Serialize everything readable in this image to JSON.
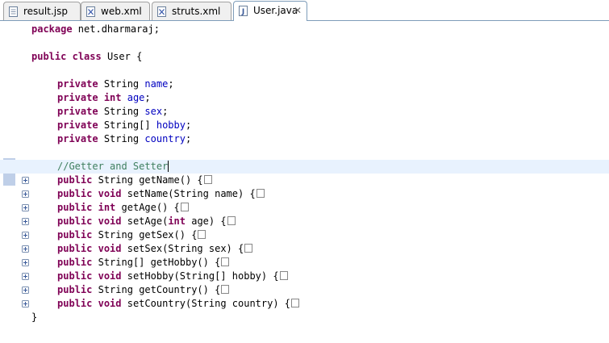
{
  "tabs": [
    {
      "label": "result.jsp",
      "icon": "jsp-file-icon"
    },
    {
      "label": "web.xml",
      "icon": "xml-file-icon"
    },
    {
      "label": "struts.xml",
      "icon": "xml-file-icon"
    },
    {
      "label": "User.java",
      "icon": "java-file-icon",
      "active": true,
      "close": "✕"
    }
  ],
  "code": {
    "line1": {
      "kw": "package",
      "rest": " net.dharmaraj;"
    },
    "line3": {
      "kw1": "public",
      "kw2": "class",
      "rest": " User {"
    },
    "fields": [
      {
        "mod": "private",
        "type": "String",
        "typeKw": false,
        "name": "name"
      },
      {
        "mod": "private",
        "type": "int",
        "typeKw": true,
        "name": "age"
      },
      {
        "mod": "private",
        "type": "String",
        "typeKw": false,
        "name": "sex"
      },
      {
        "mod": "private",
        "type": "String[]",
        "typeKw": false,
        "name": "hobby"
      },
      {
        "mod": "private",
        "type": "String",
        "typeKw": false,
        "name": "country"
      }
    ],
    "comment": "//Getter and Setter",
    "methods": [
      {
        "kw": "public",
        "type": "String",
        "typeKw": false,
        "sig": "getName() {"
      },
      {
        "kw": "public",
        "type": "void",
        "typeKw": true,
        "sig": "setName(String name) {"
      },
      {
        "kw": "public",
        "type": "int",
        "typeKw": true,
        "sig": "getAge() {"
      },
      {
        "kw": "public",
        "type": "void",
        "typeKw": true,
        "sig": "setAge(",
        "paramKw": "int",
        "sigRest": " age) {"
      },
      {
        "kw": "public",
        "type": "String",
        "typeKw": false,
        "sig": "getSex() {"
      },
      {
        "kw": "public",
        "type": "void",
        "typeKw": true,
        "sig": "setSex(String sex) {"
      },
      {
        "kw": "public",
        "type": "String[]",
        "typeKw": false,
        "sig": "getHobby() {"
      },
      {
        "kw": "public",
        "type": "void",
        "typeKw": true,
        "sig": "setHobby(String[] hobby) {"
      },
      {
        "kw": "public",
        "type": "String",
        "typeKw": false,
        "sig": "getCountry() {"
      },
      {
        "kw": "public",
        "type": "void",
        "typeKw": true,
        "sig": "setCountry(String country) {"
      }
    ],
    "closing": "}"
  },
  "colors": {
    "keyword": "#7f0055",
    "field": "#0000c0",
    "comment": "#3f7f5f",
    "current_line": "#e8f2fe"
  }
}
